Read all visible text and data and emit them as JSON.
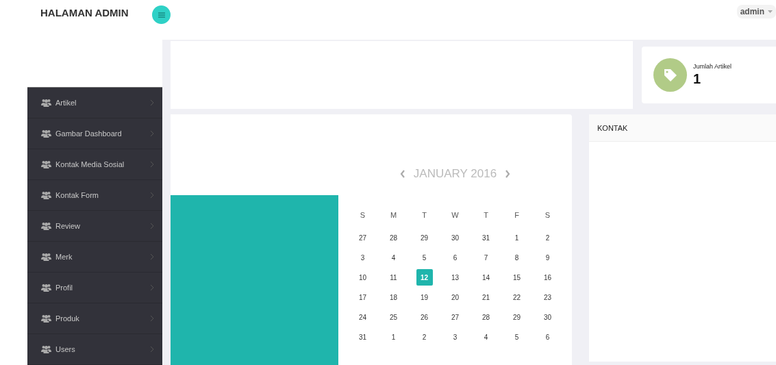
{
  "header": {
    "brand": "HALAMAN ADMIN",
    "user": "admin"
  },
  "sidebar": {
    "items": [
      {
        "label": "Artikel"
      },
      {
        "label": "Gambar Dashboard"
      },
      {
        "label": "Kontak Media Sosial"
      },
      {
        "label": "Kontak Form"
      },
      {
        "label": "Review"
      },
      {
        "label": "Merk"
      },
      {
        "label": "Profil"
      },
      {
        "label": "Produk"
      },
      {
        "label": "Users"
      }
    ]
  },
  "stat": {
    "label": "Jumlah Artikel",
    "value": "1"
  },
  "calendar": {
    "title": "JANUARY 2016",
    "weekdays": [
      "S",
      "M",
      "T",
      "W",
      "T",
      "F",
      "S"
    ],
    "weeks": [
      [
        {
          "day": "27",
          "selected": false
        },
        {
          "day": "28",
          "selected": false
        },
        {
          "day": "29",
          "selected": false
        },
        {
          "day": "30",
          "selected": false
        },
        {
          "day": "31",
          "selected": false
        },
        {
          "day": "1",
          "selected": false
        },
        {
          "day": "2",
          "selected": false
        }
      ],
      [
        {
          "day": "3",
          "selected": false
        },
        {
          "day": "4",
          "selected": false
        },
        {
          "day": "5",
          "selected": false
        },
        {
          "day": "6",
          "selected": false
        },
        {
          "day": "7",
          "selected": false
        },
        {
          "day": "8",
          "selected": false
        },
        {
          "day": "9",
          "selected": false
        }
      ],
      [
        {
          "day": "10",
          "selected": false
        },
        {
          "day": "11",
          "selected": false
        },
        {
          "day": "12",
          "selected": true
        },
        {
          "day": "13",
          "selected": false
        },
        {
          "day": "14",
          "selected": false
        },
        {
          "day": "15",
          "selected": false
        },
        {
          "day": "16",
          "selected": false
        }
      ],
      [
        {
          "day": "17",
          "selected": false
        },
        {
          "day": "18",
          "selected": false
        },
        {
          "day": "19",
          "selected": false
        },
        {
          "day": "20",
          "selected": false
        },
        {
          "day": "21",
          "selected": false
        },
        {
          "day": "22",
          "selected": false
        },
        {
          "day": "23",
          "selected": false
        }
      ],
      [
        {
          "day": "24",
          "selected": false
        },
        {
          "day": "25",
          "selected": false
        },
        {
          "day": "26",
          "selected": false
        },
        {
          "day": "27",
          "selected": false
        },
        {
          "day": "28",
          "selected": false
        },
        {
          "day": "29",
          "selected": false
        },
        {
          "day": "30",
          "selected": false
        }
      ],
      [
        {
          "day": "31",
          "selected": false
        },
        {
          "day": "1",
          "selected": false
        },
        {
          "day": "2",
          "selected": false
        },
        {
          "day": "3",
          "selected": false
        },
        {
          "day": "4",
          "selected": false
        },
        {
          "day": "5",
          "selected": false
        },
        {
          "day": "6",
          "selected": false
        }
      ]
    ]
  },
  "contact_panel": {
    "title": "KONTAK"
  }
}
